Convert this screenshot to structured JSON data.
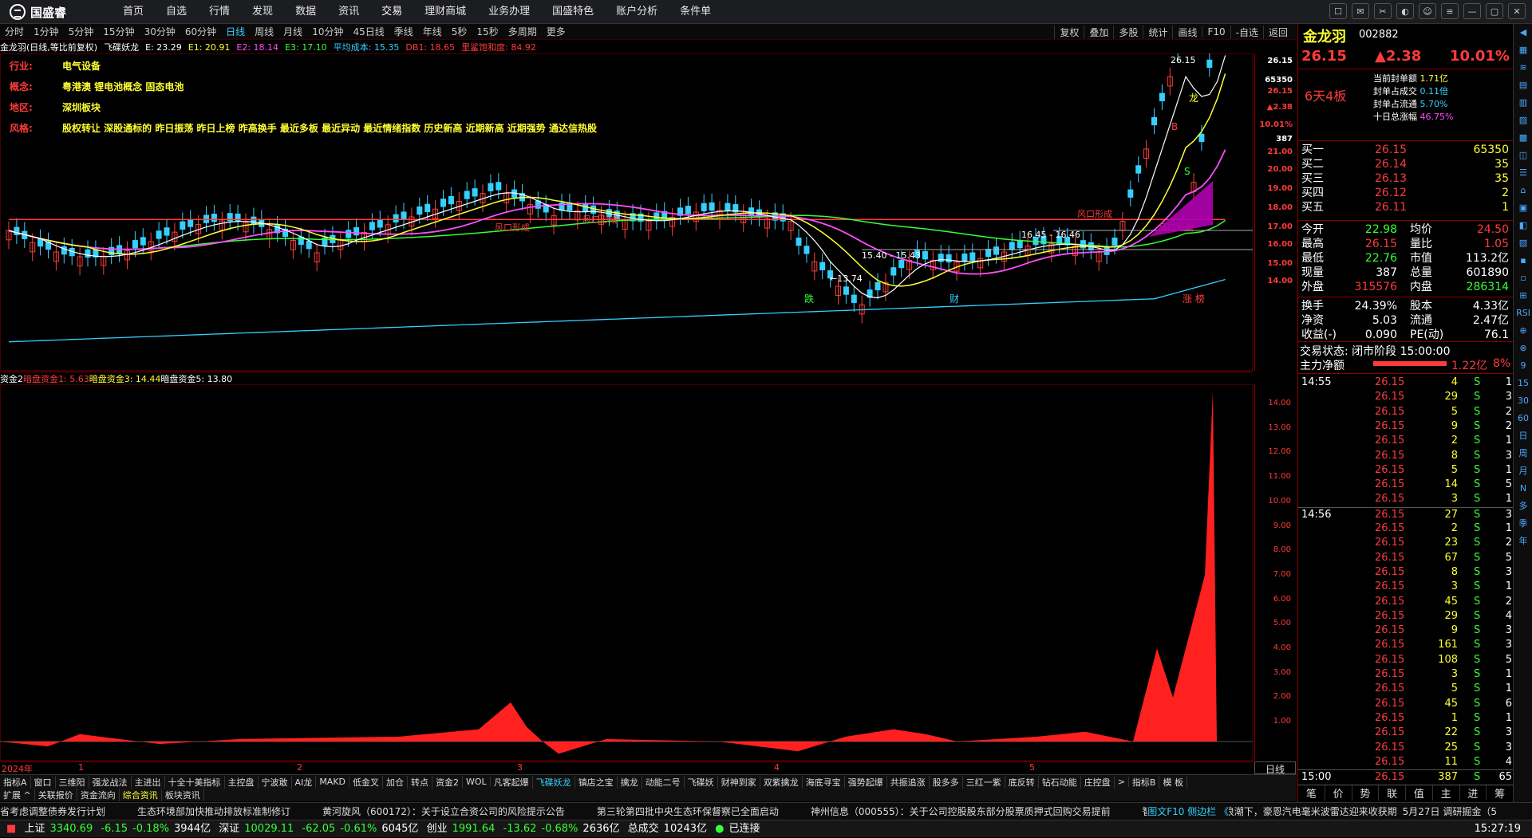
{
  "app": {
    "brand": "国盛睿",
    "nav": [
      "首页",
      "自选",
      "行情",
      "发现",
      "数据",
      "资讯",
      "交易",
      "理财商城",
      "业务办理",
      "国盛特色",
      "账户分析",
      "条件单"
    ]
  },
  "periods": [
    "分时",
    "1分钟",
    "5分钟",
    "15分钟",
    "30分钟",
    "60分钟",
    "日线",
    "周线",
    "月线",
    "10分钟",
    "45日线",
    "季线",
    "年线",
    "5秒",
    "15秒",
    "多周期",
    "更多"
  ],
  "active_period": "日线",
  "toolbar": [
    "复权",
    "叠加",
    "多股",
    "统计",
    "画线",
    "F10",
    "-自选",
    "返回"
  ],
  "ma_line": {
    "name": "金龙羽(日线,等比前复权)",
    "indicator": "飞碟妖龙",
    "items": [
      {
        "t": "E: 23.29",
        "c": "#ffffff"
      },
      {
        "t": "E1: 20.91",
        "c": "#ffff33"
      },
      {
        "t": "E2: 18.14",
        "c": "#ff4dff"
      },
      {
        "t": "E3: 17.10",
        "c": "#35ff35"
      },
      {
        "t": "平均成本: 15.35",
        "c": "#35d0ff"
      },
      {
        "t": "DB1: 18.65",
        "c": "#ff3b3b"
      },
      {
        "t": "里鲨饱和度: 84.92",
        "c": "#ff3b3b"
      }
    ]
  },
  "info": [
    {
      "k": "行业:",
      "v": "电气设备"
    },
    {
      "k": "概念:",
      "v": "粤港澳 锂电池概念 固态电池"
    },
    {
      "k": "地区:",
      "v": "深圳板块"
    },
    {
      "k": "风格:",
      "v": "股权转让 深股通标的 昨日振荡 昨日上榜 昨高换手 最近多板 最近异动 最近情绪指数 历史新高 近期新高 近期强势 通达信热股"
    }
  ],
  "chart_labels": {
    "low": "←13.74",
    "range1": "15.40 - 15.43",
    "range2": "16.45 - 16.46",
    "high": "26.15",
    "feng1": "风口形成",
    "feng2": "风口形成",
    "feng3": "风口形成",
    "feng4": "风口形成",
    "ev1": "跌",
    "ev2": "财",
    "ev3": "涨 榜",
    "long": "龙",
    "b": "B",
    "s": "S"
  },
  "price_axis": [
    "26.15",
    "65350",
    "26.15",
    "▲2.38",
    "10.01%",
    "387",
    "21.00",
    "20.00",
    "19.00",
    "18.00",
    "17.00",
    "16.00",
    "15.00",
    "14.00"
  ],
  "fund_line": {
    "name": "资金2",
    "items": [
      {
        "t": "暗盘资金1: 5.63",
        "c": "#ff3b3b"
      },
      {
        "t": "暗盘资金3: 14.44",
        "c": "#ffff33"
      },
      {
        "t": "暗盘资金5: 13.80",
        "c": "#ffffff"
      }
    ]
  },
  "fund_axis": [
    "14.00",
    "13.00",
    "12.00",
    "11.00",
    "10.00",
    "9.00",
    "8.00",
    "7.00",
    "6.00",
    "5.00",
    "4.00",
    "3.00",
    "2.00",
    "1.00"
  ],
  "x_axis": [
    "2024年",
    "1",
    "2",
    "3",
    "4",
    "5"
  ],
  "day_label": "日线",
  "ind_tabs": [
    "指标A",
    "窗口",
    "三维阳",
    "强龙战法",
    "主进出",
    "十全十美指标",
    "主控盘",
    "宁波敢",
    "AI龙",
    "MAKD",
    "低金叉",
    "加仓",
    "转点",
    "资金2",
    "WOL",
    "凡客起爆",
    "飞碟妖龙",
    "镇店之宝",
    "擒龙",
    "动能二号",
    "飞碟妖",
    "财神到家",
    "双紫擒龙",
    "海底寻宝",
    "强势起爆",
    "共振追涨",
    "股多多",
    "三红一紫",
    "底反转",
    "钻石动能",
    "庄控盘",
    ">",
    "指标B",
    "模 板"
  ],
  "active_ind_tab": "飞碟妖龙",
  "bottom_tabs": [
    "扩展 ^",
    "关联报价",
    "资金流向",
    "综合资讯",
    "板块资讯"
  ],
  "active_bottom_tab": "综合资讯",
  "news": [
    "省考虑调整债券发行计划",
    "生态环境部加快推动排放标准制修订",
    "黄河旋风（600172）：关于设立合资公司的风险提示公告",
    "第三轮第四批中央生态环保督察已全面启动",
    "神州信息（000555）：关于公司控股股东部分股票质押式回购交易提前",
    "智驾平权•国产替代浪潮下，豪恩汽电毫米波雷达迎来收获期"
  ],
  "news_right": "5月27日 调研掘金（5",
  "news_side": "图文F10 侧边栏 《",
  "status": {
    "sh_label": "上证",
    "sh": "3340.69",
    "sh_chg": "-6.15",
    "sh_pct": "-0.18%",
    "sh_amt": "3944亿",
    "sz_label": "深证",
    "sz": "10029.11",
    "sz_chg": "-62.05",
    "sz_pct": "-0.61%",
    "sz_amt": "6045亿",
    "cy_label": "创业",
    "cy": "1991.64",
    "cy_chg": "-13.62",
    "cy_pct": "-0.68%",
    "cy_amt": "2636亿",
    "tot_label": "总成交",
    "tot": "10243亿",
    "conn": "已连接",
    "time": "15:27:19"
  },
  "quote": {
    "name": "金龙羽",
    "code": "002882",
    "price": "26.15",
    "chg": "▲2.38",
    "pct": "10.01%",
    "board": "6天4板",
    "seal": [
      {
        "k": "当前封单额",
        "v": "1.71亿"
      },
      {
        "k": "封单占成交",
        "v": "0.11倍"
      },
      {
        "k": "封单占流通",
        "v": "5.70%"
      },
      {
        "k": "十日总涨幅",
        "v": "46.75%"
      }
    ],
    "bids": [
      {
        "l": "买一",
        "p": "26.15",
        "v": "65350"
      },
      {
        "l": "买二",
        "p": "26.14",
        "v": "35"
      },
      {
        "l": "买三",
        "p": "26.13",
        "v": "35"
      },
      {
        "l": "买四",
        "p": "26.12",
        "v": "2"
      },
      {
        "l": "买五",
        "p": "26.11",
        "v": "1"
      }
    ],
    "stats": [
      {
        "a": "今开",
        "av": "22.98",
        "b": "均价",
        "bv": "24.50"
      },
      {
        "a": "最高",
        "av": "26.15",
        "b": "量比",
        "bv": "1.05"
      },
      {
        "a": "最低",
        "av": "22.76",
        "b": "市值",
        "bv": "113.2亿"
      },
      {
        "a": "现量",
        "av": "387",
        "b": "总量",
        "bv": "601890"
      },
      {
        "a": "外盘",
        "av": "315576",
        "b": "内盘",
        "bv": "286314"
      }
    ],
    "stats2": [
      {
        "a": "换手",
        "av": "24.39%",
        "b": "股本",
        "bv": "4.33亿"
      },
      {
        "a": "净资",
        "av": "5.03",
        "b": "流通",
        "bv": "2.47亿"
      },
      {
        "a": "收益(-)",
        "av": "0.090",
        "b": "PE(动)",
        "bv": "76.1"
      }
    ],
    "trade_state": "交易状态: 闭市阶段 15:00:00",
    "main_net_label": "主力净额",
    "main_net": "1.22亿",
    "main_pct": "8%",
    "ticks": [
      {
        "t": "14:55",
        "p": "26.15",
        "v": "4",
        "s": "S",
        "n": "1"
      },
      {
        "t": "",
        "p": "26.15",
        "v": "29",
        "s": "S",
        "n": "3"
      },
      {
        "t": "",
        "p": "26.15",
        "v": "5",
        "s": "S",
        "n": "2"
      },
      {
        "t": "",
        "p": "26.15",
        "v": "9",
        "s": "S",
        "n": "2"
      },
      {
        "t": "",
        "p": "26.15",
        "v": "2",
        "s": "S",
        "n": "1"
      },
      {
        "t": "",
        "p": "26.15",
        "v": "8",
        "s": "S",
        "n": "3"
      },
      {
        "t": "",
        "p": "26.15",
        "v": "5",
        "s": "S",
        "n": "1"
      },
      {
        "t": "",
        "p": "26.15",
        "v": "14",
        "s": "S",
        "n": "5"
      },
      {
        "t": "",
        "p": "26.15",
        "v": "3",
        "s": "S",
        "n": "1"
      },
      {
        "t": "14:56",
        "p": "26.15",
        "v": "27",
        "s": "S",
        "n": "3"
      },
      {
        "t": "",
        "p": "26.15",
        "v": "2",
        "s": "S",
        "n": "1"
      },
      {
        "t": "",
        "p": "26.15",
        "v": "23",
        "s": "S",
        "n": "2"
      },
      {
        "t": "",
        "p": "26.15",
        "v": "67",
        "s": "S",
        "n": "5"
      },
      {
        "t": "",
        "p": "26.15",
        "v": "8",
        "s": "S",
        "n": "3"
      },
      {
        "t": "",
        "p": "26.15",
        "v": "3",
        "s": "S",
        "n": "1"
      },
      {
        "t": "",
        "p": "26.15",
        "v": "45",
        "s": "S",
        "n": "2"
      },
      {
        "t": "",
        "p": "26.15",
        "v": "29",
        "s": "S",
        "n": "4"
      },
      {
        "t": "",
        "p": "26.15",
        "v": "9",
        "s": "S",
        "n": "3"
      },
      {
        "t": "",
        "p": "26.15",
        "v": "161",
        "s": "S",
        "n": "3"
      },
      {
        "t": "",
        "p": "26.15",
        "v": "108",
        "s": "S",
        "n": "5"
      },
      {
        "t": "",
        "p": "26.15",
        "v": "3",
        "s": "S",
        "n": "1"
      },
      {
        "t": "",
        "p": "26.15",
        "v": "5",
        "s": "S",
        "n": "1"
      },
      {
        "t": "",
        "p": "26.15",
        "v": "45",
        "s": "S",
        "n": "6"
      },
      {
        "t": "",
        "p": "26.15",
        "v": "1",
        "s": "S",
        "n": "1"
      },
      {
        "t": "",
        "p": "26.15",
        "v": "22",
        "s": "S",
        "n": "3"
      },
      {
        "t": "",
        "p": "26.15",
        "v": "25",
        "s": "S",
        "n": "3"
      },
      {
        "t": "",
        "p": "26.15",
        "v": "11",
        "s": "S",
        "n": "4"
      },
      {
        "t": "15:00",
        "p": "26.15",
        "v": "387",
        "s": "S",
        "n": "65"
      }
    ],
    "tabs": [
      "笔",
      "价",
      "势",
      "联",
      "值",
      "主",
      "进",
      "筹"
    ]
  },
  "side_icons": [
    "◀",
    "▦",
    "≋",
    "▤",
    "▥",
    "▨",
    "▩",
    "◫",
    "☰",
    "⌂",
    "▣",
    "◧",
    "▧",
    "▪",
    "▫",
    "⊞",
    "RSI",
    "⊕",
    "⊗",
    "9",
    "15",
    "30",
    "60",
    "日",
    "周",
    "月",
    "N",
    "多",
    "季",
    "年"
  ],
  "colors": {
    "up": "#ff3b3b",
    "down": "#35ff35",
    "accent": "#35d0ff",
    "yellow": "#ffff33",
    "axis": "#8a0000"
  }
}
